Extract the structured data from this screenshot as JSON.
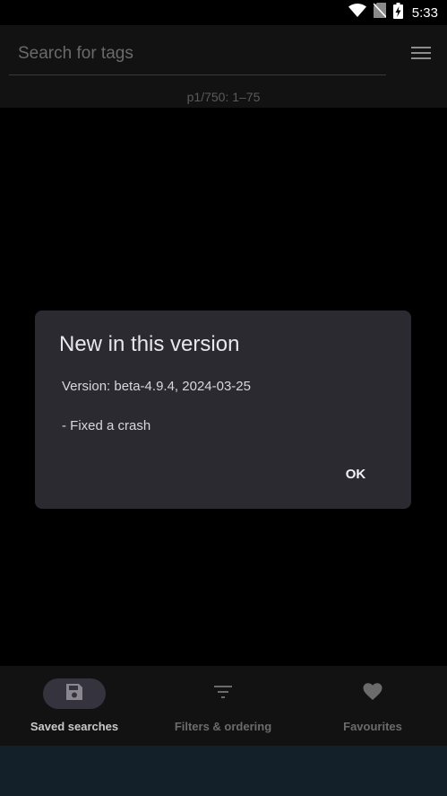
{
  "status_bar": {
    "time": "5:33",
    "icons": [
      "wifi-icon",
      "no-sim-icon",
      "battery-charging-icon"
    ]
  },
  "search": {
    "placeholder": "Search for tags",
    "value": ""
  },
  "menu": {
    "icon": "hamburger-menu-icon"
  },
  "page_info": "p1/750: 1–75",
  "dialog": {
    "title": "New in this version",
    "version_line": "Version: beta-4.9.4, 2024-03-25",
    "changes": [
      "- Fixed a crash"
    ],
    "ok_label": "OK"
  },
  "bottom_nav": {
    "items": [
      {
        "label": "Saved searches",
        "icon": "floppy-disk-icon",
        "active": true
      },
      {
        "label": "Filters & ordering",
        "icon": "filter-icon",
        "active": false
      },
      {
        "label": "Favourites",
        "icon": "heart-icon",
        "active": false
      }
    ]
  },
  "colors": {
    "background": "#000000",
    "dialog_bg": "#2b2a30",
    "active_pill": "#35333d",
    "system_bar": "#13202a"
  }
}
